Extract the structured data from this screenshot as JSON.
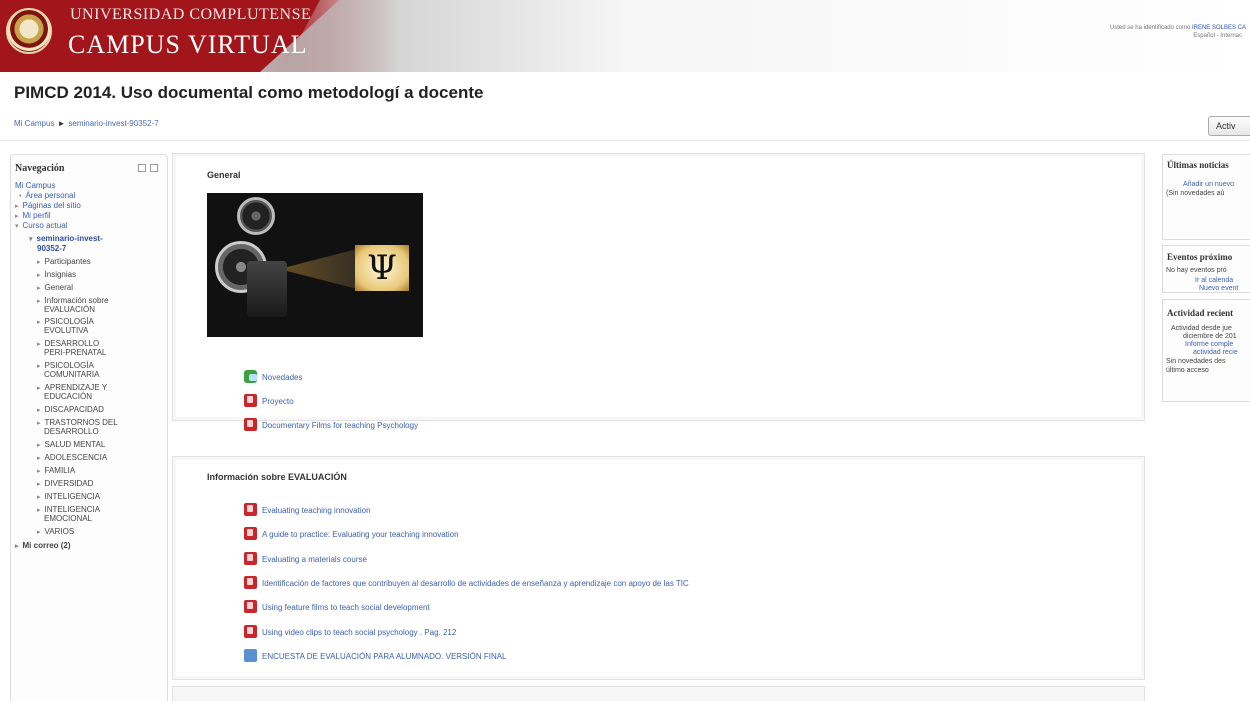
{
  "header": {
    "university": "UNIVERSIDAD COMPLUTENSE",
    "campus": "CAMPUS VIRTUAL",
    "login_prefix": "Usted se ha identificado como ",
    "login_user": "IRENE SOLBES CA",
    "language": "Español - Internac"
  },
  "page": {
    "title": "PIMCD 2014. Uso documental como metodologí a docente",
    "edit_button": "Activ"
  },
  "breadcrumb": {
    "home": "Mi Campus",
    "separator": "►",
    "course": "seminario-invest-90352-7"
  },
  "nav": {
    "title": "Navegación",
    "items": [
      {
        "label": "Mi Campus",
        "arrow": ""
      },
      {
        "label": "Área personal",
        "arrow": "•"
      },
      {
        "label": "Páginas del sitio",
        "arrow": "▸"
      },
      {
        "label": "Mi perfil",
        "arrow": "▸"
      },
      {
        "label": "Curso actual",
        "arrow": "▾"
      },
      {
        "label": "seminario-invest-",
        "arrow": "▾"
      },
      {
        "label": "90352-7",
        "arrow": ""
      },
      {
        "label": "Participantes",
        "arrow": "▸"
      },
      {
        "label": "Insignias",
        "arrow": "▸"
      },
      {
        "label": "General",
        "arrow": "▸"
      },
      {
        "label": "Información sobre",
        "arrow": "▸"
      },
      {
        "label": "EVALUACIÓN",
        "arrow": ""
      },
      {
        "label": "PSICOLOGÍA",
        "arrow": "▸"
      },
      {
        "label": "EVOLUTIVA",
        "arrow": ""
      },
      {
        "label": "DESARROLLO",
        "arrow": "▸"
      },
      {
        "label": "PERI-PRENATAL",
        "arrow": ""
      },
      {
        "label": "PSICOLOGÍA",
        "arrow": "▸"
      },
      {
        "label": "COMUNITARIA",
        "arrow": ""
      },
      {
        "label": "APRENDIZAJE Y",
        "arrow": "▸"
      },
      {
        "label": "EDUCACIÓN",
        "arrow": ""
      },
      {
        "label": "DISCAPACIDAD",
        "arrow": "▸"
      },
      {
        "label": "TRASTORNOS DEL",
        "arrow": "▸"
      },
      {
        "label": "DESARROLLO",
        "arrow": ""
      },
      {
        "label": "SALUD MENTAL",
        "arrow": "▸"
      },
      {
        "label": "ADOLESCENCIA",
        "arrow": "▸"
      },
      {
        "label": "FAMILIA",
        "arrow": "▸"
      },
      {
        "label": "DIVERSIDAD",
        "arrow": "▸"
      },
      {
        "label": "INTELIGENCIA",
        "arrow": "▸"
      },
      {
        "label": "INTELIGENCIA",
        "arrow": "▸"
      },
      {
        "label": "EMOCIONAL",
        "arrow": ""
      },
      {
        "label": "VARIOS",
        "arrow": "▸"
      },
      {
        "label": "Mi correo (2)",
        "arrow": "▸"
      }
    ]
  },
  "general": {
    "title": "General",
    "image_text": "Ψ",
    "activities": [
      {
        "label": "Novedades",
        "icon": "forum-icon"
      },
      {
        "label": "Proyecto",
        "icon": "pdf-icon"
      },
      {
        "label": "Documentary Films for teaching Psychology",
        "icon": "pdf-icon"
      }
    ]
  },
  "evaluacion": {
    "title": "Información sobre EVALUACIÓN",
    "activities": [
      {
        "label": "Evaluating teaching innovation",
        "icon": "pdf-icon"
      },
      {
        "label": "A guide to practice: Evaluating your teaching innovation",
        "icon": "pdf-icon"
      },
      {
        "label": "Evaluating a materials course",
        "icon": "pdf-icon"
      },
      {
        "label": "Identificación de factores que contribuyen al desarrollo de actividades de enseñanza y aprendizaje con apoyo de las TIC",
        "icon": "pdf-icon"
      },
      {
        "label": "Using feature films to teach social development",
        "icon": "pdf-icon"
      },
      {
        "label": "Using video clips to teach social psychology . Pag. 212",
        "icon": "pdf-icon"
      },
      {
        "label": "ENCUESTA DE EVALUACIÓN PARA ALUMNADO. VERSIÓN FINAL",
        "icon": "questionnaire-icon"
      }
    ]
  },
  "right": {
    "news_title": "Últimas noticias",
    "news_add": "Añadir un nuevo",
    "news_none": "(Sin novedades aú",
    "events_title": "Eventos próximo",
    "events_none": "No hay eventos pró",
    "events_calendar": "Ir al calenda",
    "events_new": "Nuevo event",
    "activity_title": "Actividad recient",
    "activity_since1": "Actividad desde jue",
    "activity_since2": "diciembre de 201",
    "activity_report1": "Informe comple",
    "activity_report2": "actividad recie",
    "activity_none1": "Sin novedades des",
    "activity_none2": "último acceso"
  }
}
